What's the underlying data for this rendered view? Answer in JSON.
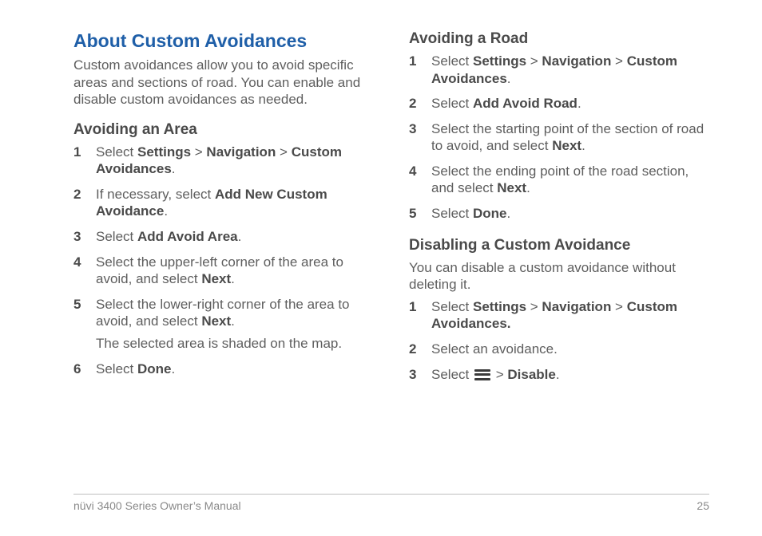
{
  "leftColumn": {
    "title": "About Custom Avoidances",
    "intro": "Custom avoidances allow you to avoid specific areas and sections of road. You can enable and disable custom avoidances as needed.",
    "section1": {
      "heading": "Avoiding an Area",
      "steps": {
        "s1": {
          "prefix": "Select ",
          "b1": "Settings",
          "sep": " > ",
          "b2": "Navigation",
          "b3": "Custom Avoidances",
          "suffix": "."
        },
        "s2": {
          "prefix": "If necessary, select ",
          "b1": "Add New Custom Avoidance",
          "suffix": "."
        },
        "s3": {
          "prefix": "Select ",
          "b1": "Add Avoid Area",
          "suffix": "."
        },
        "s4": {
          "prefix": "Select the upper-left corner of the area to avoid, and select ",
          "b1": "Next",
          "suffix": "."
        },
        "s5": {
          "prefix": "Select the lower-right corner of the area to avoid, and select ",
          "b1": "Next",
          "suffix": "."
        },
        "note": "The selected area is shaded on the map.",
        "s6": {
          "prefix": "Select ",
          "b1": "Done",
          "suffix": "."
        }
      }
    }
  },
  "rightColumn": {
    "section1": {
      "heading": "Avoiding a Road",
      "steps": {
        "s1": {
          "prefix": "Select ",
          "b1": "Settings",
          "sep": " > ",
          "b2": "Navigation",
          "b3": "Custom Avoidances",
          "suffix": "."
        },
        "s2": {
          "prefix": "Select ",
          "b1": "Add Avoid Road",
          "suffix": "."
        },
        "s3": {
          "prefix": "Select the starting point of the section of road to avoid, and select ",
          "b1": "Next",
          "suffix": "."
        },
        "s4": {
          "prefix": "Select the ending point of the road section, and select ",
          "b1": "Next",
          "suffix": "."
        },
        "s5": {
          "prefix": "Select ",
          "b1": "Done",
          "suffix": "."
        }
      }
    },
    "section2": {
      "heading": "Disabling a Custom Avoidance",
      "intro": "You can disable a custom avoidance without deleting it.",
      "steps": {
        "s1": {
          "prefix": "Select ",
          "b1": "Settings",
          "sep": " > ",
          "b2": "Navigation",
          "b3": "Custom Avoidances.",
          "suffix": ""
        },
        "s2": {
          "text": "Select an avoidance."
        },
        "s3": {
          "prefix": "Select ",
          "sep": " > ",
          "b1": "Disable",
          "suffix": "."
        }
      }
    }
  },
  "footer": {
    "left": "nüvi 3400 Series Owner’s Manual",
    "right": "25"
  }
}
